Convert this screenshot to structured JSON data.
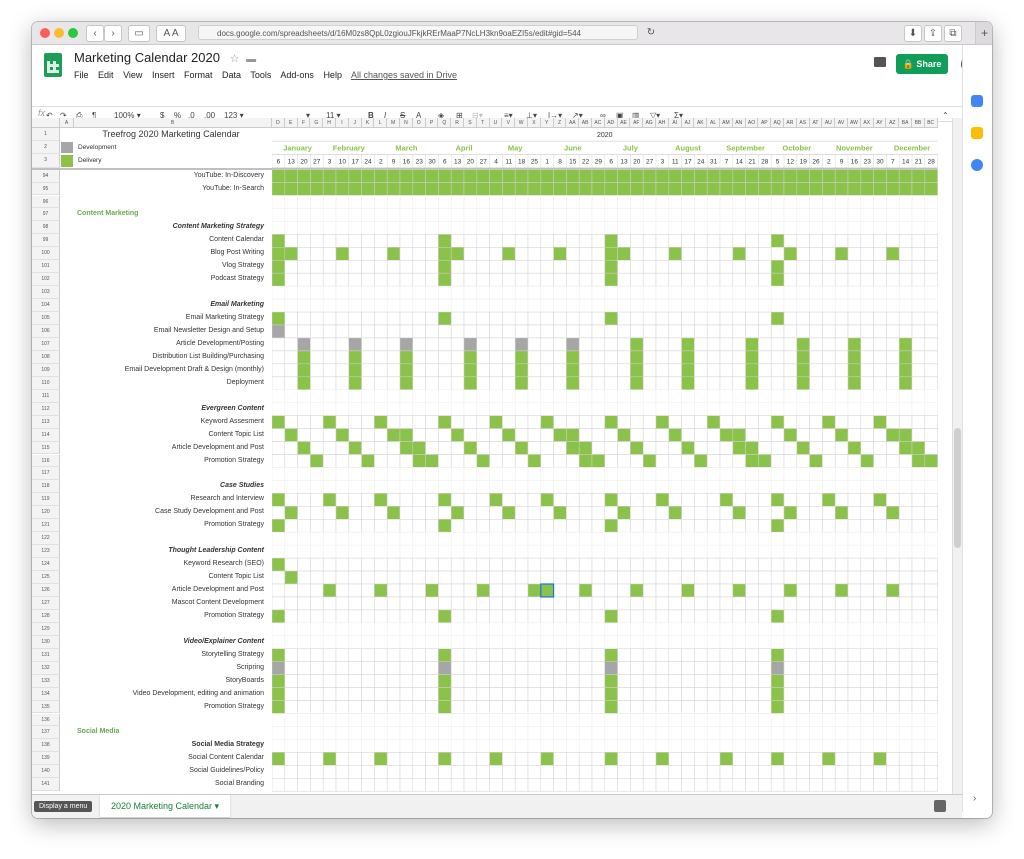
{
  "browser": {
    "url": "docs.google.com/spreadsheets/d/16M0zs8QpL0zgiouJFkjkRErMaaP7NcLH3kn9oaEZI5s/edit#gid=544"
  },
  "doc": {
    "title": "Marketing Calendar 2020",
    "menu": [
      "File",
      "Edit",
      "View",
      "Insert",
      "Format",
      "Data",
      "Tools",
      "Add-ons",
      "Help"
    ],
    "saved_status": "All changes saved in Drive",
    "share_label": "Share"
  },
  "toolbar": {
    "zoom": "100%",
    "currency": "$",
    "percent": "%",
    "dec_less": ".0",
    "dec_more": ".00",
    "format": "123",
    "font_size": "11",
    "bold": "B",
    "italic": "I",
    "strike": "S",
    "text_color": "A"
  },
  "formula_bar": {
    "fx": "fx"
  },
  "sheet": {
    "title": "Treefrog 2020 Marketing Calendar",
    "year": "2020",
    "legend": [
      {
        "label": "Development",
        "color": "#a6a6a6"
      },
      {
        "label": "Delivery",
        "color": "#8bc34a"
      }
    ],
    "months": [
      "January",
      "February",
      "March",
      "April",
      "May",
      "June",
      "July",
      "August",
      "September",
      "October",
      "November",
      "December"
    ],
    "weeks": [
      "6",
      "13",
      "20",
      "27",
      "3",
      "10",
      "17",
      "24",
      "2",
      "9",
      "16",
      "23",
      "30",
      "6",
      "13",
      "20",
      "27",
      "4",
      "11",
      "18",
      "25",
      "1",
      "8",
      "15",
      "22",
      "29",
      "6",
      "13",
      "20",
      "27",
      "3",
      "11",
      "17",
      "24",
      "31",
      "7",
      "14",
      "21",
      "28",
      "5",
      "12",
      "19",
      "26",
      "2",
      "9",
      "16",
      "23",
      "30",
      "7",
      "14",
      "21",
      "28"
    ],
    "columns": [
      "A",
      "B",
      "D",
      "E",
      "F",
      "G",
      "H",
      "I",
      "J",
      "K",
      "L",
      "M",
      "N",
      "O",
      "P",
      "Q",
      "R",
      "S",
      "T",
      "U",
      "V",
      "W",
      "X",
      "Y",
      "Z",
      "AA",
      "AB",
      "AC",
      "AD",
      "AE",
      "AF",
      "AG",
      "AH",
      "AI",
      "AJ",
      "AK",
      "AL",
      "AM",
      "AN",
      "AO",
      "AP",
      "AQ",
      "AR",
      "AS",
      "AT",
      "AU",
      "AV",
      "AW",
      "AX",
      "AY",
      "AZ",
      "BA",
      "BB",
      "BC"
    ],
    "rows": [
      {
        "n": "94",
        "label": "YouTube: In-Discovery",
        "style": ""
      },
      {
        "n": "95",
        "label": "YouTube: In-Search",
        "style": ""
      },
      {
        "n": "96",
        "label": "",
        "style": ""
      },
      {
        "n": "97",
        "label": "Content Marketing",
        "style": "section"
      },
      {
        "n": "98",
        "label": "Content Marketing Strategy",
        "style": "head"
      },
      {
        "n": "99",
        "label": "Content Calendar",
        "style": ""
      },
      {
        "n": "100",
        "label": "Blog Post Writing",
        "style": ""
      },
      {
        "n": "101",
        "label": "Vlog Strategy",
        "style": ""
      },
      {
        "n": "102",
        "label": "Podcast Strategy",
        "style": ""
      },
      {
        "n": "103",
        "label": "",
        "style": ""
      },
      {
        "n": "104",
        "label": "Email Marketing",
        "style": "head"
      },
      {
        "n": "105",
        "label": "Email Marketing Strategy",
        "style": ""
      },
      {
        "n": "106",
        "label": "Email Newsletter Design and Setup",
        "style": ""
      },
      {
        "n": "107",
        "label": "Article Development/Posting",
        "style": ""
      },
      {
        "n": "108",
        "label": "Distribution List Building/Purchasing",
        "style": ""
      },
      {
        "n": "109",
        "label": "Email Development Draft & Design (monthly)",
        "style": ""
      },
      {
        "n": "110",
        "label": "Deployment",
        "style": ""
      },
      {
        "n": "111",
        "label": "",
        "style": ""
      },
      {
        "n": "112",
        "label": "Evergreen Content",
        "style": "head"
      },
      {
        "n": "113",
        "label": "Keyword Assesment",
        "style": ""
      },
      {
        "n": "114",
        "label": "Content Topic List",
        "style": ""
      },
      {
        "n": "115",
        "label": "Article Development and Post",
        "style": ""
      },
      {
        "n": "116",
        "label": "Promotion Strategy",
        "style": ""
      },
      {
        "n": "117",
        "label": "",
        "style": ""
      },
      {
        "n": "118",
        "label": "Case Studies",
        "style": "head"
      },
      {
        "n": "119",
        "label": "Research and Interview",
        "style": ""
      },
      {
        "n": "120",
        "label": "Case Study Development and Post",
        "style": ""
      },
      {
        "n": "121",
        "label": "Promotion Strategy",
        "style": ""
      },
      {
        "n": "122",
        "label": "",
        "style": ""
      },
      {
        "n": "123",
        "label": "Thought Leadership Content",
        "style": "head"
      },
      {
        "n": "124",
        "label": "Keyword Research (SEO)",
        "style": ""
      },
      {
        "n": "125",
        "label": "Content Topic List",
        "style": ""
      },
      {
        "n": "126",
        "label": "Article Development and Post",
        "style": ""
      },
      {
        "n": "127",
        "label": "Mascot Content Development",
        "style": ""
      },
      {
        "n": "128",
        "label": "Promotion Strategy",
        "style": ""
      },
      {
        "n": "129",
        "label": "",
        "style": ""
      },
      {
        "n": "130",
        "label": "Video/Explainer Content",
        "style": "head"
      },
      {
        "n": "131",
        "label": "Storytelling Strategy",
        "style": ""
      },
      {
        "n": "132",
        "label": "Scripring",
        "style": ""
      },
      {
        "n": "133",
        "label": "StoryBoards",
        "style": ""
      },
      {
        "n": "134",
        "label": "Video Development, editing and animation",
        "style": ""
      },
      {
        "n": "135",
        "label": "Promotion Strategy",
        "style": ""
      },
      {
        "n": "136",
        "label": "",
        "style": ""
      },
      {
        "n": "137",
        "label": "Social Media",
        "style": "section"
      },
      {
        "n": "138",
        "label": "Social Media Strategy",
        "style": "sub"
      },
      {
        "n": "139",
        "label": "Social Content Calendar",
        "style": ""
      },
      {
        "n": "140",
        "label": "Social Guidelines/Policy",
        "style": ""
      },
      {
        "n": "141",
        "label": "Social Branding",
        "style": ""
      }
    ]
  },
  "tabs": {
    "active": "2020 Marketing Calendar",
    "tooltip": "Display a menu"
  }
}
